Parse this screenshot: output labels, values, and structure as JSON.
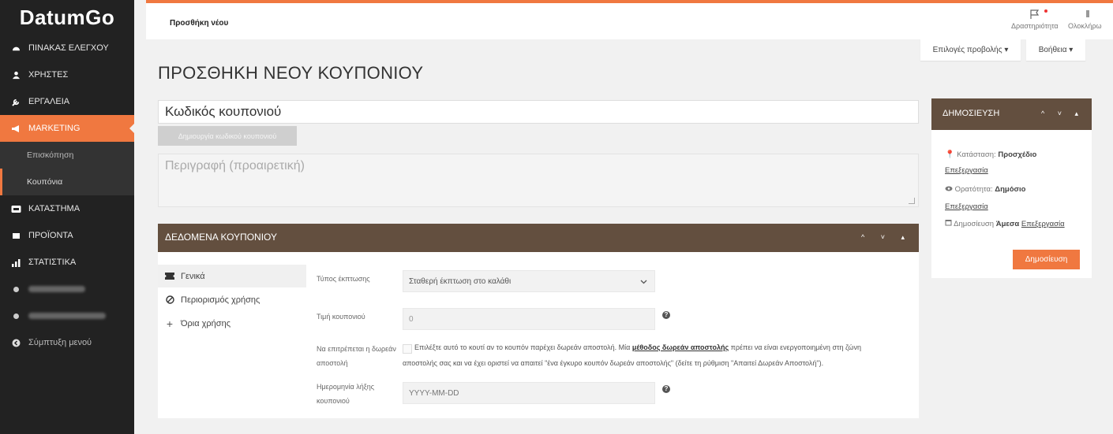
{
  "app": {
    "logo": "DatumGo"
  },
  "sidebar": {
    "items": [
      {
        "label": "ΠΙΝΑΚΑΣ ΕΛΕΓΧΟΥ",
        "icon": "dashboard-icon"
      },
      {
        "label": "ΧΡΗΣΤΕΣ",
        "icon": "users-icon"
      },
      {
        "label": "ΕΡΓΑΛΕΙΑ",
        "icon": "wrench-icon"
      },
      {
        "label": "MARKETING",
        "icon": "megaphone-icon"
      },
      {
        "label": "ΚΑΤΑΣΤΗΜΑ",
        "icon": "store-icon"
      },
      {
        "label": "ΠΡΟΪΟΝΤΑ",
        "icon": "box-icon"
      },
      {
        "label": "ΣΤΑΤΙΣΤΙΚΑ",
        "icon": "bar-chart-icon"
      }
    ],
    "sub": [
      {
        "label": "Επισκόπηση"
      },
      {
        "label": "Κουπόνια"
      }
    ],
    "collapse": "Σύμπτυξη μενού"
  },
  "topbar": {
    "breadcrumb": "Προσθήκη νέου",
    "activity": "Δραστηριότητα",
    "fullscreen": "Ολοκλήρω"
  },
  "screen": {
    "options": "Επιλογές προβολής ▾",
    "help": "Βοήθεια ▾"
  },
  "main": {
    "title": "ΠΡΟΣΘΗΚΗ ΝΕΟΥ ΚΟΥΠΟΝΙΟΥ",
    "code_placeholder": "Κωδικός κουπονιού",
    "generate": "Δημιουργία κωδικού κουπονιού",
    "desc_placeholder": "Περιγραφή (προαιρετική)"
  },
  "panel": {
    "title": "ΔΕΔΟΜΕΝΑ ΚΟΥΠΟΝΙΟΥ",
    "controls": "^ ˅ ▴",
    "tabs": [
      {
        "label": "Γενικά",
        "icon": "ticket-icon"
      },
      {
        "label": "Περιορισμός χρήσης",
        "icon": "ban-icon"
      },
      {
        "label": "Όρια χρήσης",
        "icon": "plus-icon"
      }
    ],
    "fields": {
      "discount_type_label": "Τύπος έκπτωσης",
      "discount_type_value": "Σταθερή έκπτωση στο καλάθι",
      "amount_label": "Τιμή κουπονιού",
      "amount_value": "0",
      "free_ship_label_1": "Να επιτρέπεται η δωρεάν",
      "free_ship_label_2": "αποστολή",
      "free_ship_hint_1": "Επιλέξτε αυτό το κουτί αν το κουπόν παρέχει δωρεάν αποστολή. Μία",
      "free_ship_link": "μέθοδος δωρεάν αποστολής",
      "free_ship_hint_2": "πρέπει να είναι ενεργοποιημένη στη ζώνη",
      "free_ship_hint_3": "αποστολής σας και να έχει οριστεί να απαιτεί \"ένα έγκυρο κουπόν δωρεάν αποστολής\" (δείτε τη ρύθμιση \"Απαιτεί Δωρεάν Αποστολή\").",
      "expiry_label_1": "Ημερομηνία λήξης",
      "expiry_label_2": "κουπονιού",
      "expiry_placeholder": "YYYY-MM-DD"
    }
  },
  "publish": {
    "title": "ΔΗΜΟΣΙΕΥΣΗ",
    "status_label": "Κατάσταση:",
    "status_value": "Προσχέδιο",
    "visibility_label": "Ορατότητα:",
    "visibility_value": "Δημόσιο",
    "publish_label": "Δημοσίευση",
    "publish_value": "Άμεσα",
    "edit": "Επεξεργασία",
    "button": "Δημοσίευση"
  },
  "colors": {
    "accent": "#f07840",
    "panel": "#634f3f",
    "sidebar": "#222222"
  }
}
